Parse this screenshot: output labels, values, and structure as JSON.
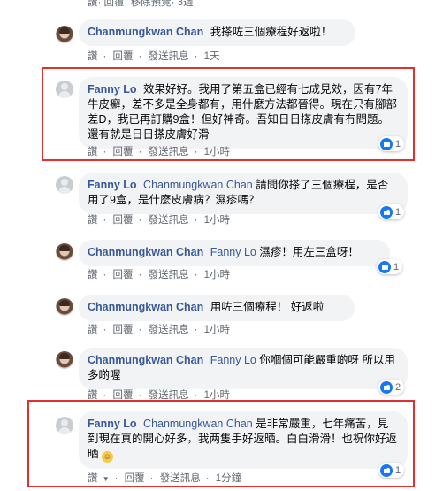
{
  "top_actions": [
    "讚",
    "回覆",
    "移除預覽",
    "3週"
  ],
  "comments": [
    {
      "author": "Chanmungkwan Chan",
      "mention": "",
      "text": "我搽咗三個療程好返啦！",
      "actions": [
        "讚",
        "回覆",
        "發送訊息"
      ],
      "time": "1天",
      "likes": "",
      "avatar": "photo"
    },
    {
      "author": "Fanny Lo",
      "mention": "",
      "text": "效果好好。我用了第五盒已經有七成見效，因有7年牛皮癬，差不多是全身都有，用什麼方法都晉得。現在只有腳部差D，我已再訂購9盒！但好神奇。吾知日日搽皮膚有冇問題。還有就是日日搽皮膚好滑",
      "actions": [
        "讚",
        "回覆",
        "發送訊息"
      ],
      "time": "1小時",
      "likes": "1",
      "avatar": "user"
    },
    {
      "author": "Fanny Lo",
      "mention": "Chanmungkwan Chan",
      "text": "請問你搽了三個療程，是否用了9盒，是什麼皮膚病？濕疹嗎？",
      "actions": [
        "讚",
        "回覆",
        "發送訊息"
      ],
      "time": "1小時",
      "likes": "1",
      "avatar": "user"
    },
    {
      "author": "Chanmungkwan Chan",
      "mention": "Fanny Lo",
      "text": "濕疹！用左三盒呀！",
      "actions": [
        "讚",
        "回覆",
        "發送訊息"
      ],
      "time": "1小時",
      "likes": "1",
      "avatar": "photo"
    },
    {
      "author": "Chanmungkwan Chan",
      "mention": "",
      "text": "用咗三個療程！ 好返啦",
      "actions": [
        "讚",
        "回覆",
        "發送訊息"
      ],
      "time": "1小時",
      "likes": "",
      "avatar": "photo"
    },
    {
      "author": "Chanmungkwan Chan",
      "mention": "Fanny Lo",
      "text": "你嗰個可能嚴重啲呀 所以用多啲喔",
      "actions": [
        "讚",
        "回覆",
        "發送訊息"
      ],
      "time": "1小時",
      "likes": "2",
      "avatar": "photo"
    },
    {
      "author": "Fanny Lo",
      "mention": "Chanmungkwan Chan",
      "text": "是非常嚴重，七年痛苦，見到現在真的開心好多，我两隻手好返晒。白白滑滑！也祝你好返晒",
      "actions": [
        "讚",
        "回覆",
        "發送訊息"
      ],
      "time": "1分鐘",
      "likes": "1",
      "avatar": "user"
    }
  ],
  "emoji": "grin-emoji",
  "colors": {
    "name": "#385898",
    "bubble": "#f2f3f5",
    "highlight": "#e03030",
    "like": "#1877f2"
  }
}
